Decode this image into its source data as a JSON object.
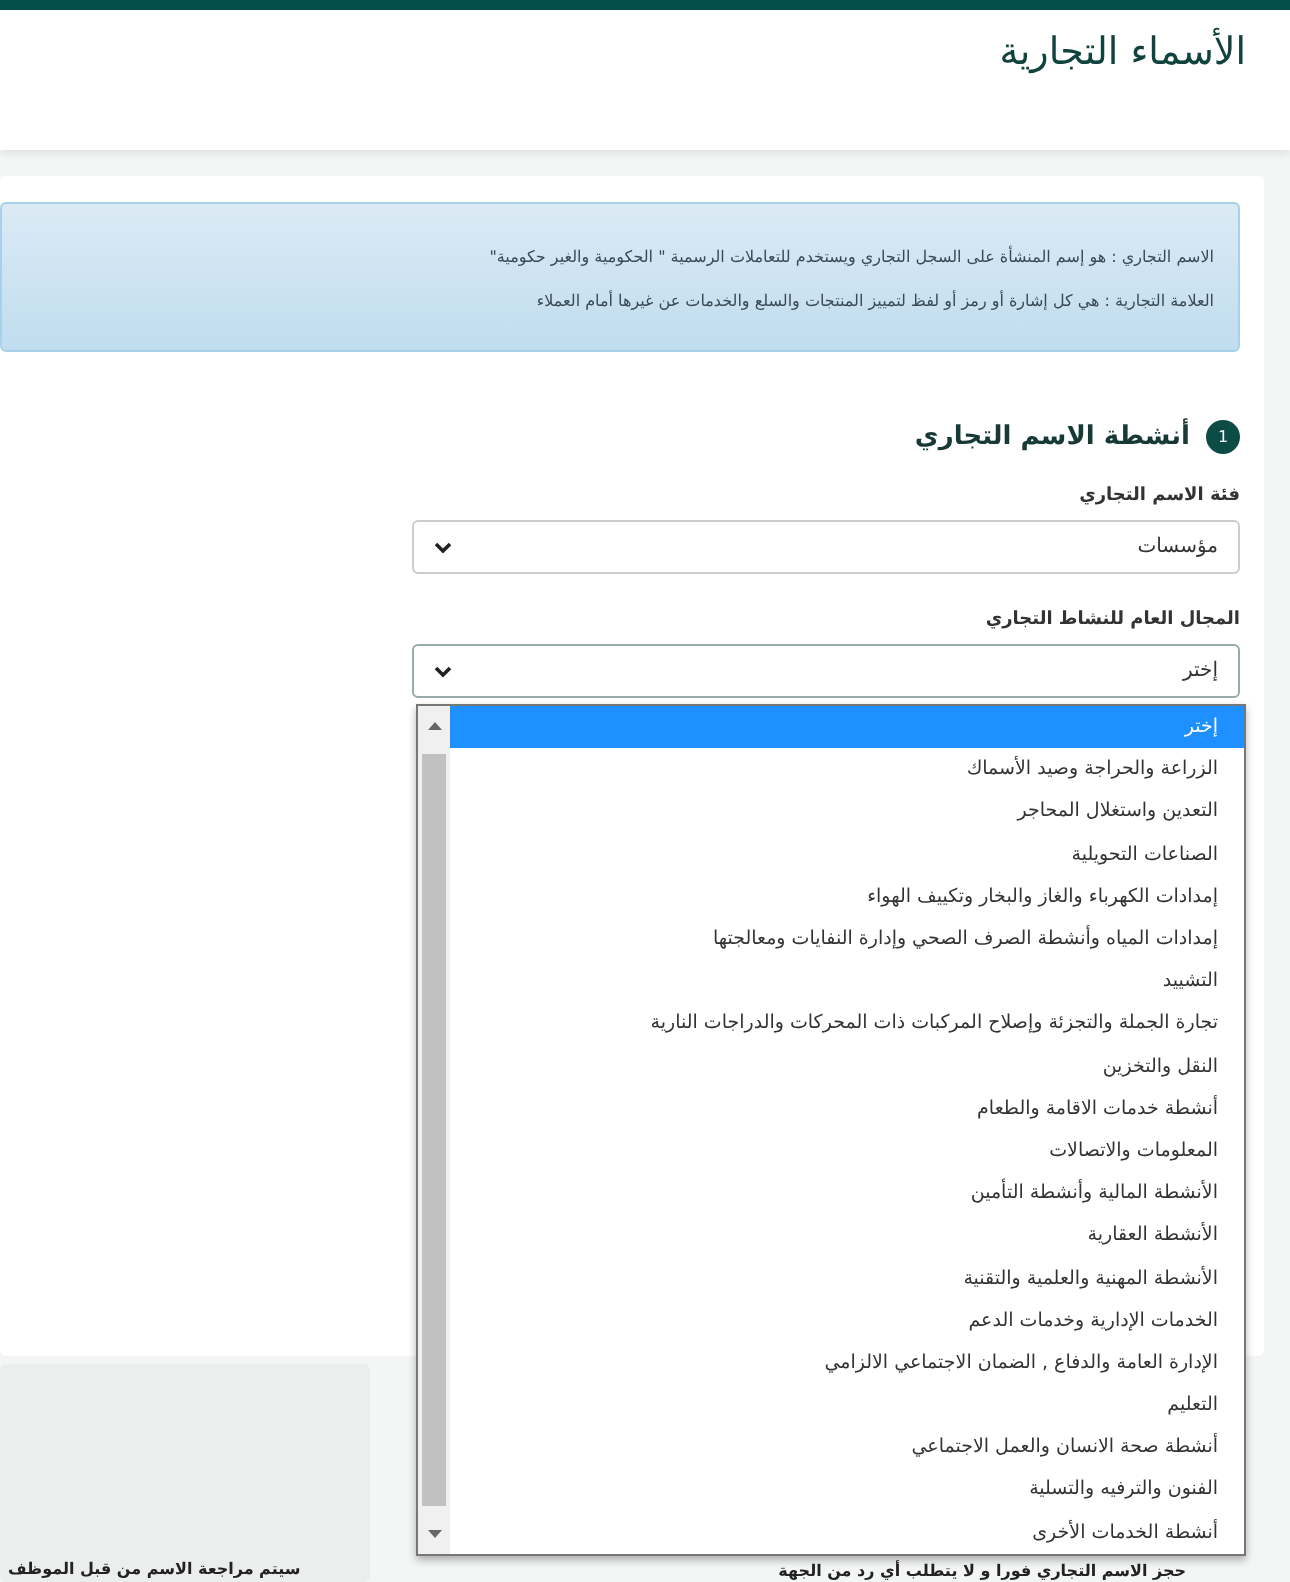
{
  "header": {
    "title": "الأسماء التجارية"
  },
  "info": {
    "lines": [
      "الاسم التجاري : هو إسم المنشأة على السجل التجاري ويستخدم للتعاملات الرسمية \" الحكومية والغير حكومية\"",
      "العلامة التجارية : هي كل إشارة أو رمز أو لفظ لتمييز المنتجات والسلع والخدمات عن غيرها أمام العملاء"
    ]
  },
  "section": {
    "number": "1",
    "title": "أنشطة الاسم التجاري"
  },
  "fields": [
    {
      "label": "فئة الاسم التجاري",
      "value": "مؤسسات",
      "expanded": false
    },
    {
      "label": "المجال العام للنشاط التجاري",
      "value": "إختر",
      "expanded": true
    }
  ],
  "dropdown": {
    "options": [
      {
        "label": "إختر",
        "selected": true
      },
      {
        "label": "الزراعة والحراجة وصيد الأسماك",
        "selected": false
      },
      {
        "label": "التعدين واستغلال المحاجر",
        "selected": false
      },
      {
        "label": "الصناعات التحويلية",
        "selected": false
      },
      {
        "label": "إمدادات الكهرباء والغاز والبخار وتكييف الهواء",
        "selected": false
      },
      {
        "label": "إمدادات المياه وأنشطة الصرف الصحي وإدارة النفايات ومعالجتها",
        "selected": false
      },
      {
        "label": "التشييد",
        "selected": false
      },
      {
        "label": "تجارة الجملة والتجزئة وإصلاح المركبات ذات المحركات والدراجات النارية",
        "selected": false
      },
      {
        "label": "النقل والتخزين",
        "selected": false
      },
      {
        "label": "أنشطة خدمات الاقامة والطعام",
        "selected": false
      },
      {
        "label": "المعلومات والاتصالات",
        "selected": false
      },
      {
        "label": "الأنشطة المالية وأنشطة التأمين",
        "selected": false
      },
      {
        "label": "الأنشطة العقارية",
        "selected": false
      },
      {
        "label": "الأنشطة المهنية والعلمية والتقنية",
        "selected": false
      },
      {
        "label": "الخدمات الإدارية وخدمات الدعم",
        "selected": false
      },
      {
        "label": "الإدارة العامة والدفاع , الضمان الاجتماعي الالزامي",
        "selected": false
      },
      {
        "label": "التعليم",
        "selected": false
      },
      {
        "label": "أنشطة صحة الانسان والعمل الاجتماعي",
        "selected": false
      },
      {
        "label": "الفنون والترفيه والتسلية",
        "selected": false
      },
      {
        "label": "أنشطة الخدمات الأخرى",
        "selected": false
      }
    ]
  },
  "notes": {
    "left": "سيتم مراجعة الاسم من قبل الموظف",
    "right": "حجز الاسم التجاري فورا و لا يتطلب أي رد من الجهة"
  }
}
